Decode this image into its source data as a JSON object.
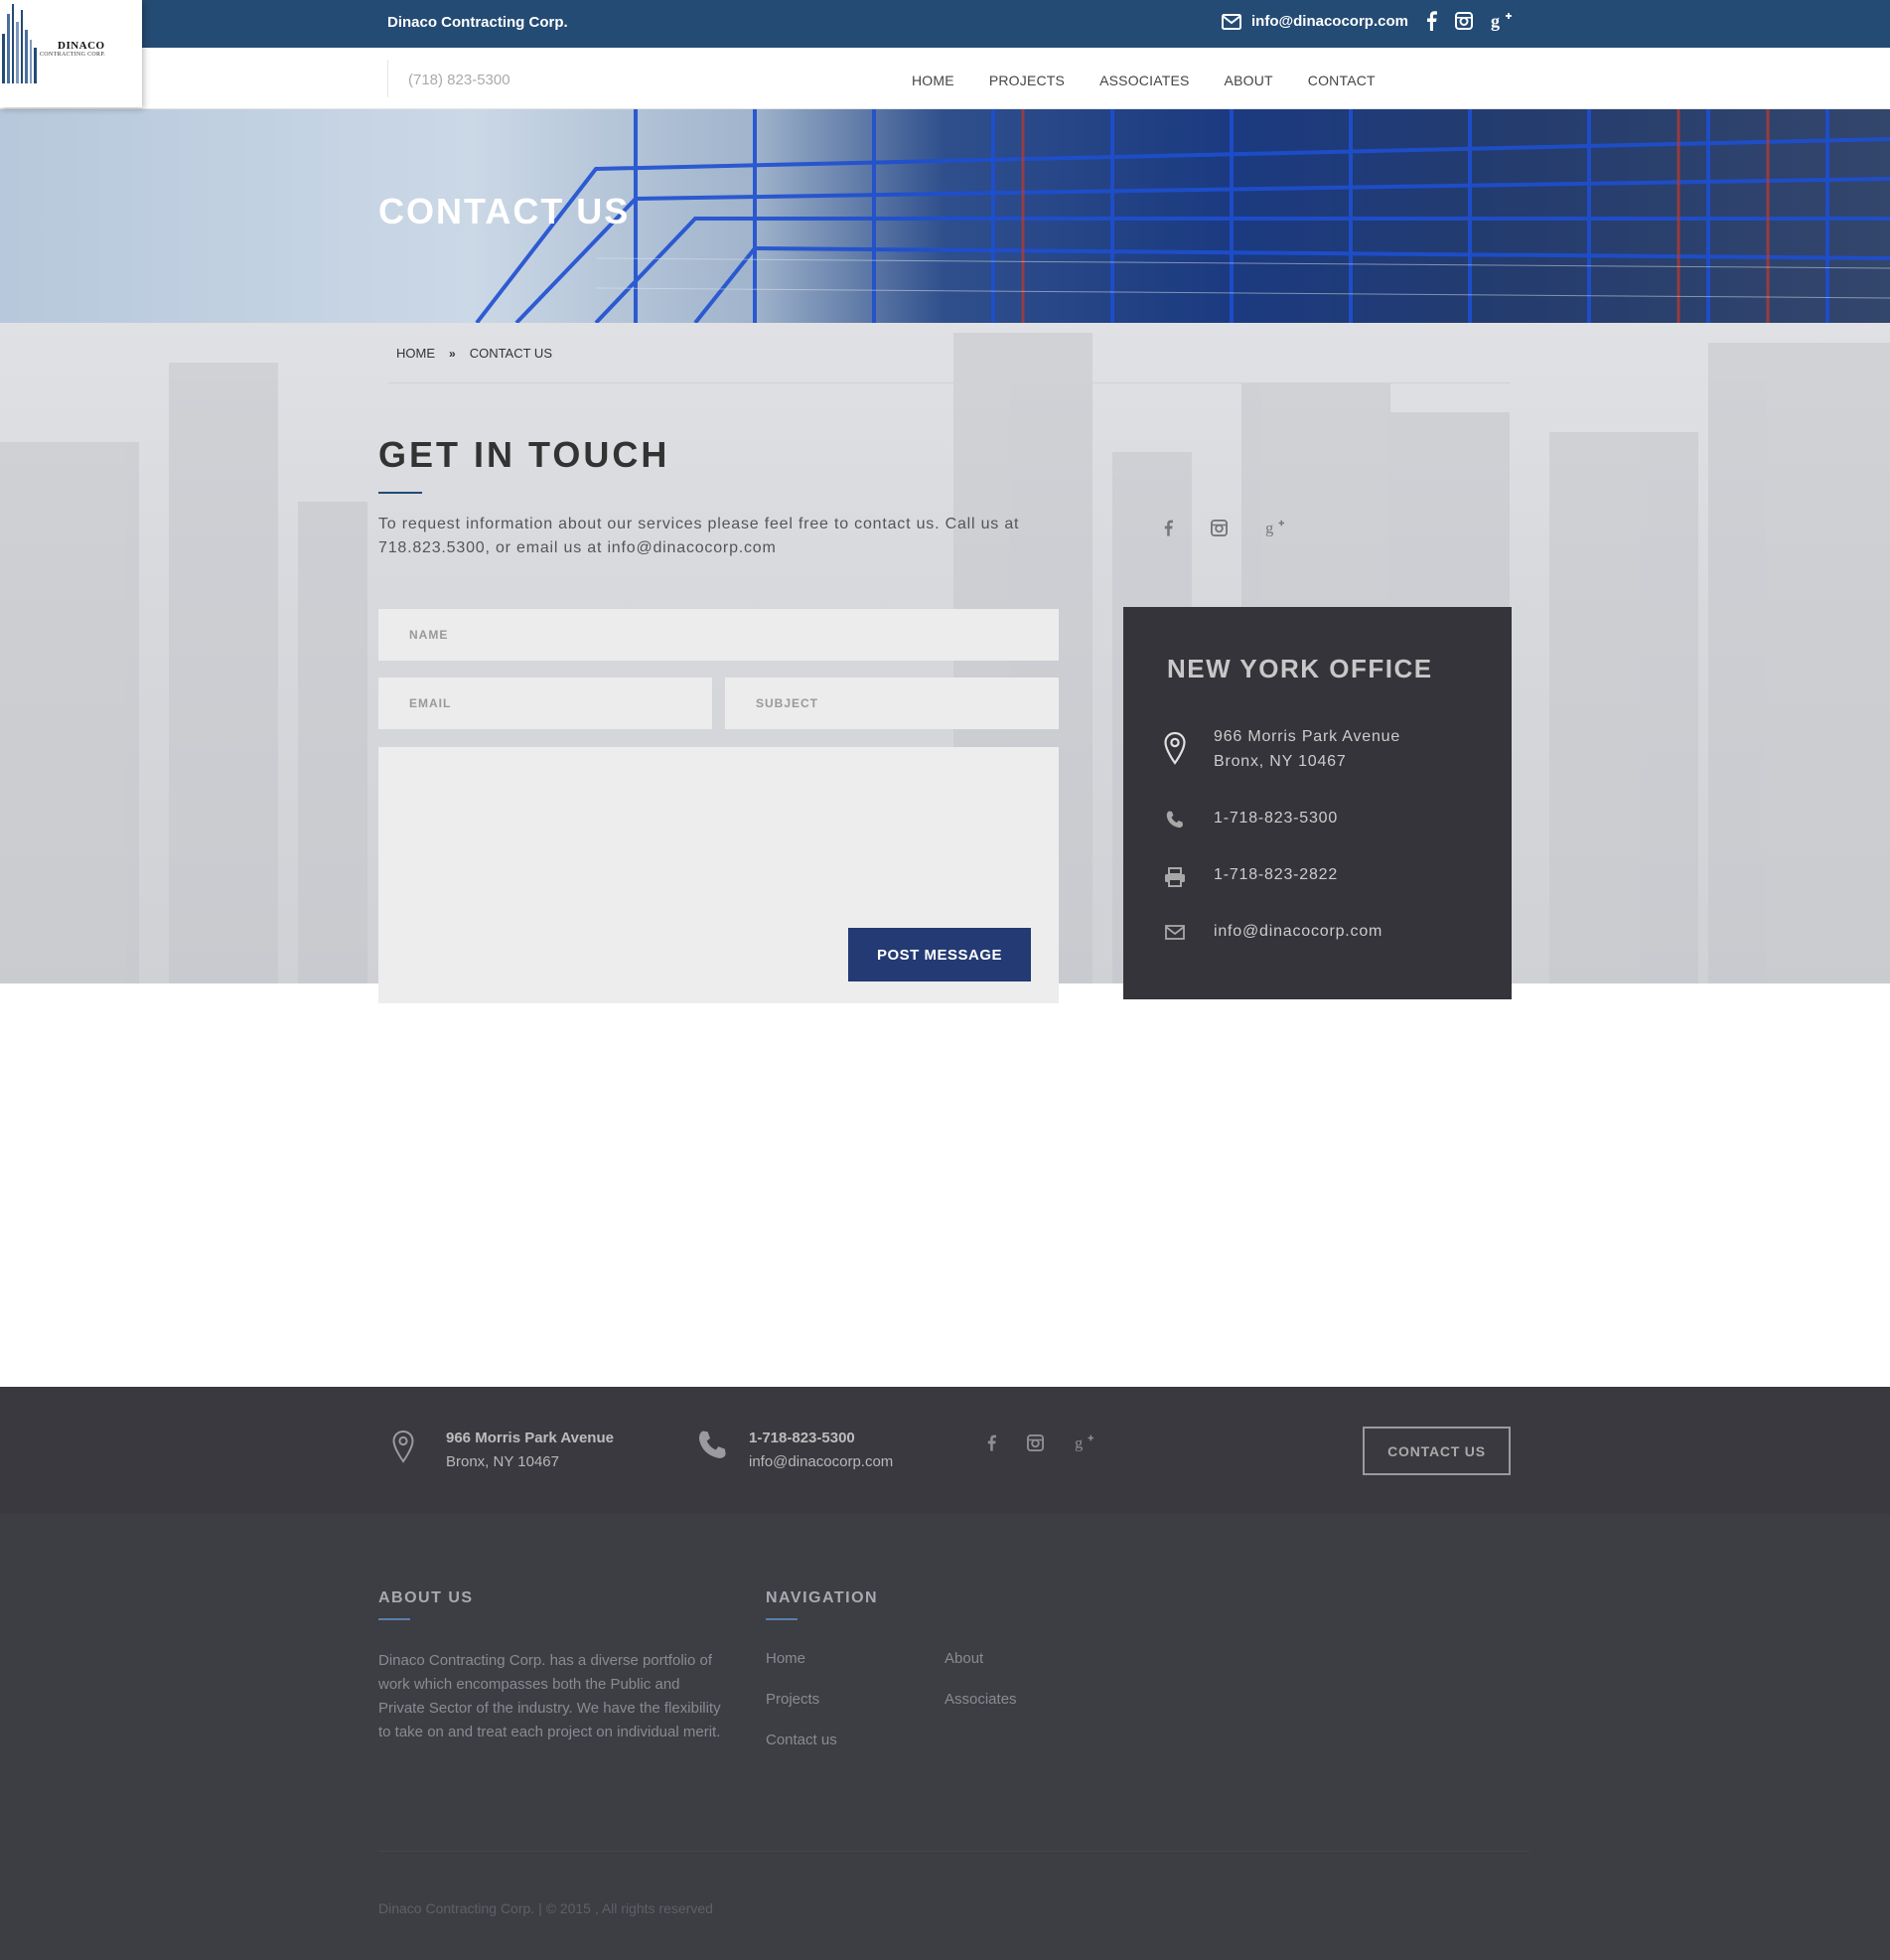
{
  "topbar": {
    "company": "Dinaco Contracting Corp.",
    "email": "info@dinacocorp.com",
    "social_icons": [
      "facebook-icon",
      "instagram-icon",
      "google-plus-icon"
    ]
  },
  "logo": {
    "name": "DINACO",
    "sub": "CONTRACTING CORP."
  },
  "nav": {
    "phone": "(718) 823-5300",
    "items": [
      "HOME",
      "PROJECTS",
      "ASSOCIATES",
      "ABOUT",
      "CONTACT"
    ]
  },
  "hero": {
    "title": "CONTACT US"
  },
  "breadcrumb": {
    "home": "HOME",
    "current": "CONTACT US"
  },
  "get_in_touch": {
    "title": "GET IN TOUCH",
    "text": "To request information about our services please feel free to contact us. Call us at 718.823.5300, or email us at info@dinacocorp.com"
  },
  "form": {
    "name_placeholder": "NAME",
    "email_placeholder": "EMAIL",
    "subject_placeholder": "SUBJECT",
    "submit_label": "POST MESSAGE"
  },
  "office": {
    "title": "NEW YORK OFFICE",
    "address_line1": "966 Morris Park Avenue",
    "address_line2": "Bronx, NY 10467",
    "phone": "1-718-823-5300",
    "fax": "1-718-823-2822",
    "email": "info@dinacocorp.com"
  },
  "footer_band": {
    "address_line1": "966 Morris Park Avenue",
    "address_line2": "Bronx, NY 10467",
    "phone": "1-718-823-5300",
    "email": "info@dinacocorp.com",
    "button_label": "CONTACT US"
  },
  "footer": {
    "about_title": "ABOUT US",
    "about_text": "Dinaco Contracting Corp. has a diverse portfolio of work which encompasses both the Public and Private Sector of the industry. We have the flexibility to take on and treat each project on individual merit.",
    "nav_title": "NAVIGATION",
    "nav_links": [
      "Home",
      "Projects",
      "Contact us",
      "About",
      "Associates"
    ],
    "copyright": "Dinaco Contracting Corp. | © 2015 , All rights reserved"
  },
  "colors": {
    "topbar": "#244b74",
    "button": "#243a74",
    "office_panel": "#34343a",
    "footer": "#3d3d44"
  }
}
